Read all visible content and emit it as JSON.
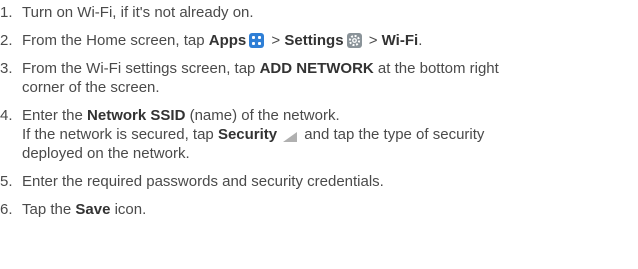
{
  "steps": [
    {
      "number": "1.",
      "text": "Turn on Wi-Fi, if it's not already on."
    },
    {
      "number": "2.",
      "t1": "From the Home screen, tap ",
      "apps": "Apps",
      "t2": " > ",
      "settings": "Settings",
      "t3": " > ",
      "wifi": "Wi-Fi",
      "t4": ".",
      "icons": [
        "apps-icon",
        "settings-icon"
      ]
    },
    {
      "number": "3.",
      "t1": "From the Wi-Fi settings screen, tap ",
      "add_network": "ADD NETWORK",
      "t2": " at the bottom right",
      "t3": "corner of the screen."
    },
    {
      "number": "4.",
      "t1": "Enter the ",
      "ssid": "Network SSID",
      "t2": " (name) of the network.",
      "t3": "If the network is secured, tap ",
      "security": "Security",
      "t4": " and tap the type of security",
      "t5": "deployed on the network.",
      "icons": [
        "dropdown-triangle-icon"
      ]
    },
    {
      "number": "5.",
      "text": "Enter the required passwords and security credentials."
    },
    {
      "number": "6.",
      "t1": "Tap the ",
      "save": "Save",
      "t2": " icon."
    }
  ]
}
